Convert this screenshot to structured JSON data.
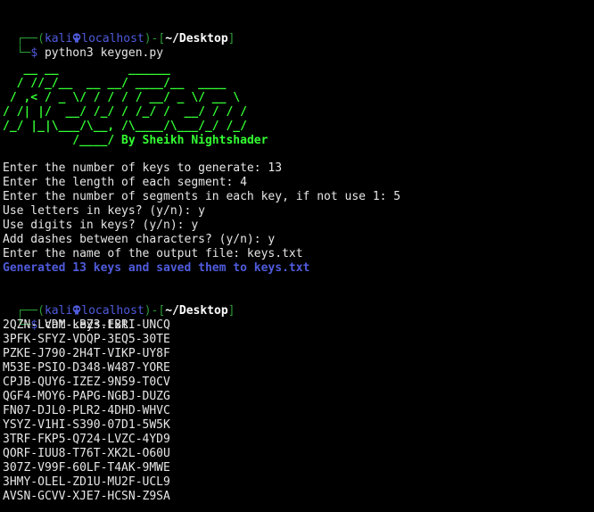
{
  "prompt1": {
    "user": "kali",
    "host": "localhost",
    "path": "~/Desktop",
    "command": "python3 keygen.py"
  },
  "banner": {
    "lines": [
      "   __ __          ______",
      "  / //_/__  __ __/ ____/__  ____",
      " / ,< / _ \\/ / / / / __/ _ \\/ __ \\",
      "/ /| |/  __/ /_/ / /_/ /  __/ / / /",
      "/_/ |_|\\___/\\__, /\\____/\\___/_/ /_/"
    ],
    "credit_prefix": "          /____/",
    "credit": " By Sheikh Nightshader"
  },
  "session": [
    "Enter the number of keys to generate: 13",
    "Enter the length of each segment: 4",
    "Enter the number of segments in each key, if not use 1: 5",
    "Use letters in keys? (y/n): y",
    "Use digits in keys? (y/n): y",
    "Add dashes between characters? (y/n): y",
    "Enter the name of the output file: keys.txt"
  ],
  "result": "Generated 13 keys and saved them to keys.txt",
  "prompt2": {
    "user": "kali",
    "host": "localhost",
    "path": "~/Desktop",
    "command": "cat keys.txt"
  },
  "keys": [
    "2QZN-LVDM-LBZ3-EBRI-UNCQ",
    "3PFK-SFYZ-VDQP-3EQ5-30TE",
    "PZKE-J790-2H4T-VIKP-UY8F",
    "M53E-PSIO-D348-W487-YORE",
    "CPJB-QUY6-IZEZ-9N59-T0CV",
    "QGF4-MOY6-PAPG-NGBJ-DUZG",
    "FN07-DJL0-PLR2-4DHD-WHVC",
    "YSYZ-V1HI-S390-07D1-5W5K",
    "3TRF-FKP5-Q724-LVZC-4YD9",
    "QORF-IUU8-T76T-XK2L-O60U",
    "307Z-V99F-60LF-T4AK-9MWE",
    "3HMY-OLEL-ZD1U-MU2F-UCL9",
    "AVSN-GCVV-XJE7-HCSN-Z9SA"
  ],
  "icons": {
    "prompt_separator": "skull-icon"
  },
  "colors": {
    "background": "#000000",
    "frame": "#2a9b35",
    "prompt_user": "#4f5bdc",
    "banner": "#33ff33",
    "result": "#4f5bdc"
  }
}
